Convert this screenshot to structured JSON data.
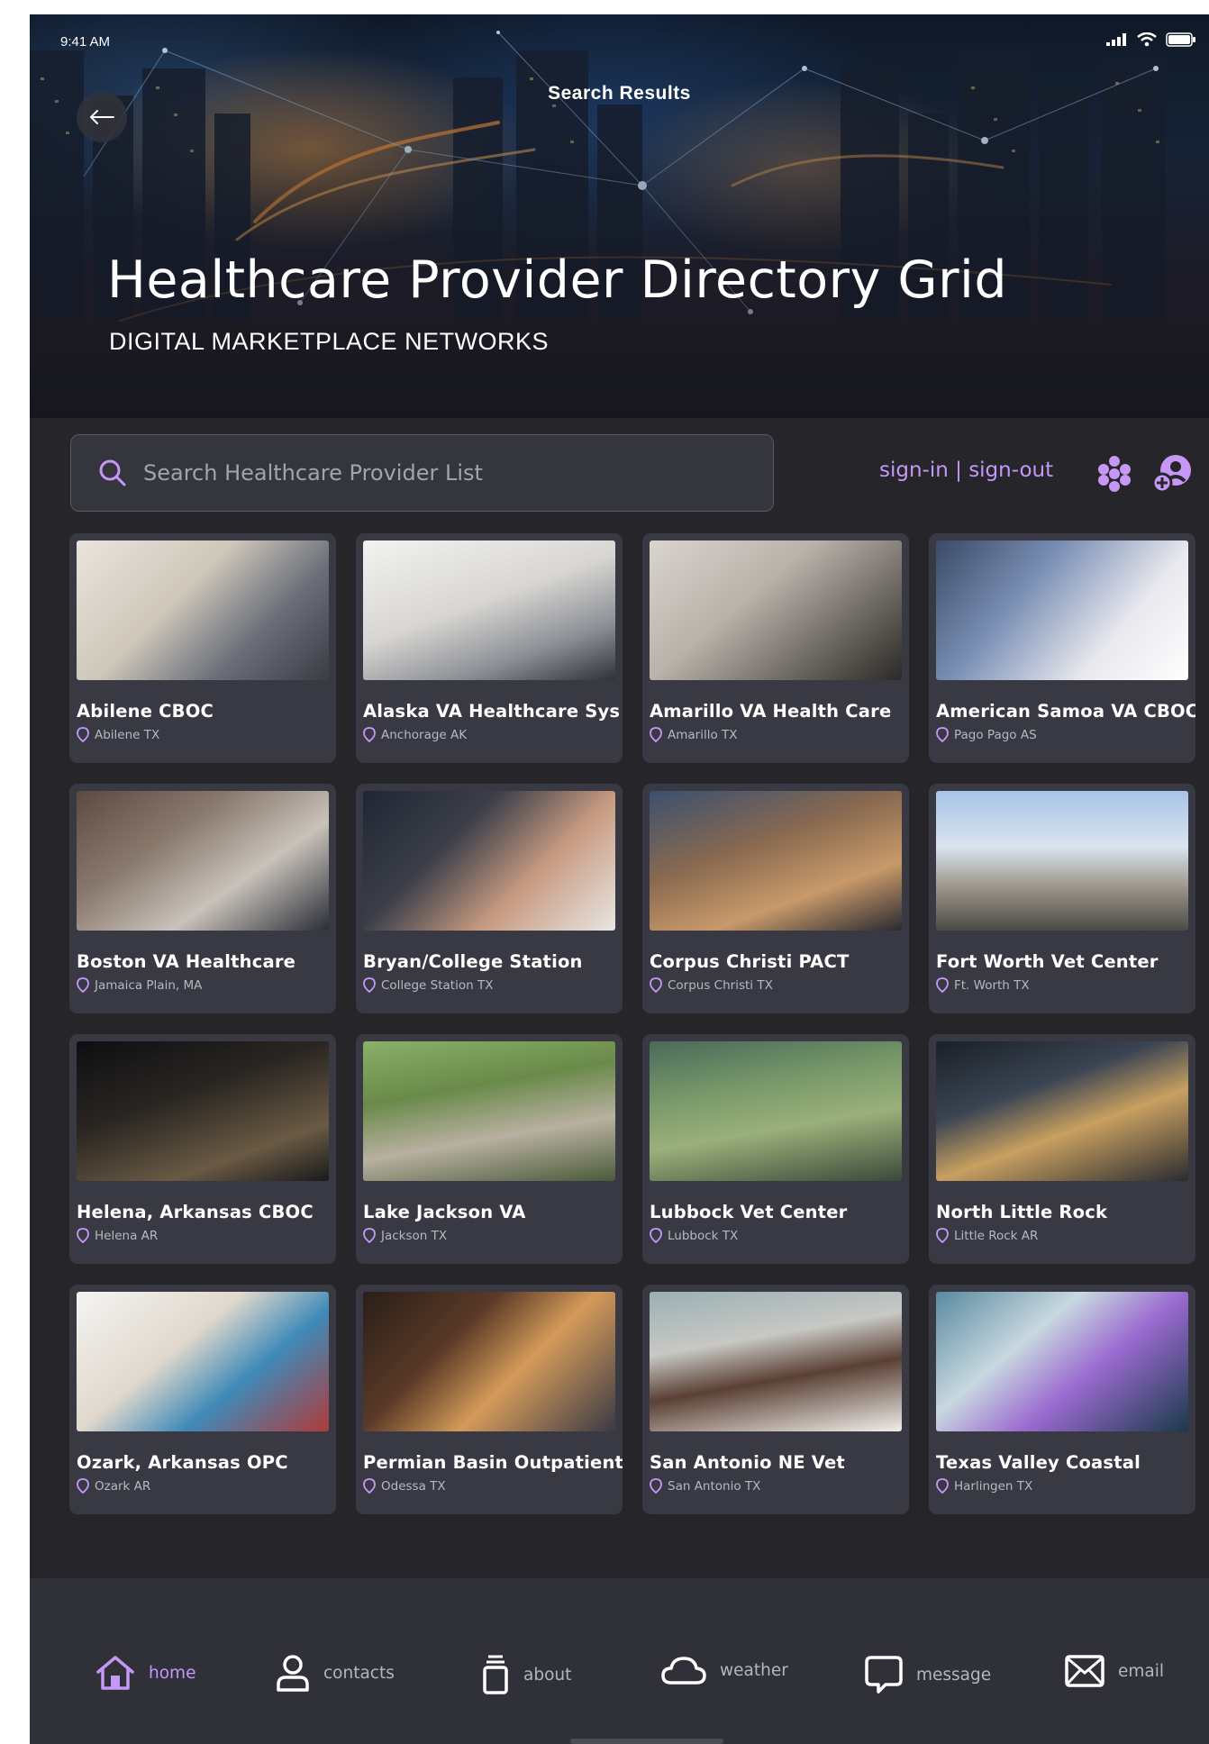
{
  "status_bar": {
    "time": "9:41 AM"
  },
  "nav": {
    "title": "Search Results",
    "back_icon": "arrow-left-icon"
  },
  "hero": {
    "title": "Healthcare Provider Directory Grid",
    "subtitle": "DIGITAL MARKETPLACE NETWORKS"
  },
  "search": {
    "placeholder": "Search Healthcare Provider List"
  },
  "auth": {
    "label": "sign-in | sign-out"
  },
  "colors": {
    "accent": "#c697f7",
    "background": "#25252a",
    "card": "#393943",
    "tabbar": "#303039"
  },
  "providers": [
    {
      "name": "Abilene CBOC",
      "location": "Abilene TX"
    },
    {
      "name": "Alaska VA Healthcare Sys",
      "location": "Anchorage AK"
    },
    {
      "name": "Amarillo VA Health Care",
      "location": "Amarillo TX"
    },
    {
      "name": "American Samoa VA CBOC",
      "location": "Pago Pago AS"
    },
    {
      "name": "Boston VA Healthcare",
      "location": "Jamaica Plain, MA"
    },
    {
      "name": "Bryan/College Station",
      "location": "College Station TX"
    },
    {
      "name": "Corpus Christi PACT",
      "location": "Corpus Christi TX"
    },
    {
      "name": "Fort Worth Vet Center",
      "location": "Ft. Worth TX"
    },
    {
      "name": "Helena, Arkansas CBOC",
      "location": "Helena AR"
    },
    {
      "name": "Lake Jackson VA",
      "location": "Jackson TX"
    },
    {
      "name": "Lubbock Vet Center",
      "location": "Lubbock TX"
    },
    {
      "name": "North Little Rock",
      "location": "Little Rock AR"
    },
    {
      "name": "Ozark, Arkansas OPC",
      "location": "Ozark AR"
    },
    {
      "name": "Permian Basin Outpatient",
      "location": "Odessa TX"
    },
    {
      "name": "San Antonio NE Vet",
      "location": "San Antonio TX"
    },
    {
      "name": "Texas Valley Coastal",
      "location": "Harlingen TX"
    }
  ],
  "tabs": [
    {
      "label": "home",
      "icon": "home-icon",
      "active": true
    },
    {
      "label": "contacts",
      "icon": "user-icon",
      "active": false
    },
    {
      "label": "about",
      "icon": "jar-icon",
      "active": false
    },
    {
      "label": "weather",
      "icon": "cloud-icon",
      "active": false
    },
    {
      "label": "message",
      "icon": "chat-bubble-icon",
      "active": false
    },
    {
      "label": "email",
      "icon": "envelope-icon",
      "active": false
    }
  ]
}
